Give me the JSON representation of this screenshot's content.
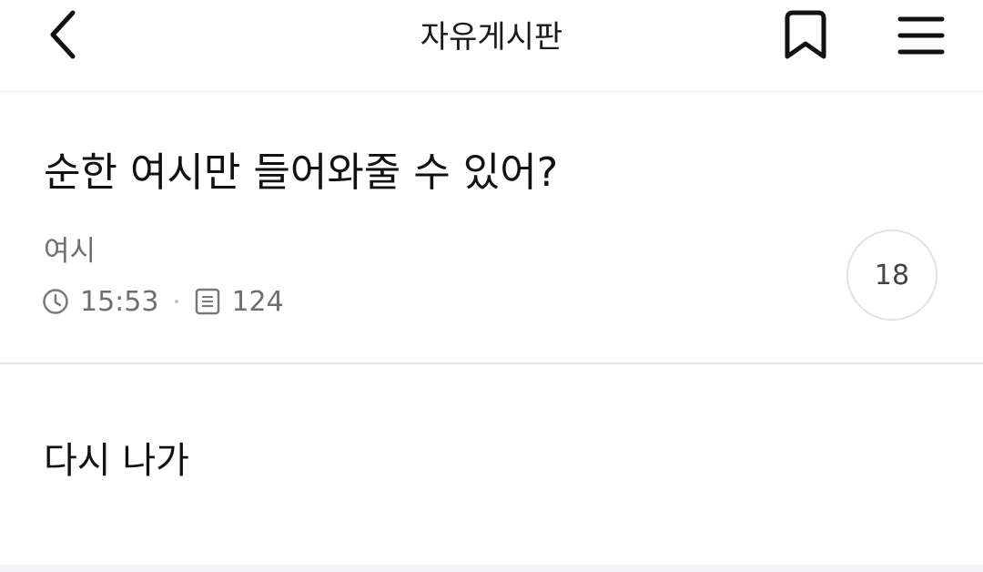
{
  "header": {
    "title": "자유게시판"
  },
  "post": {
    "title": "순한 여시만 들어와줄 수 있어?",
    "author": "여시",
    "time": "15:53",
    "views": "124",
    "comment_count": "18",
    "body": "다시 나가"
  },
  "icons": {
    "back": "chevron-left-icon",
    "bookmark": "bookmark-icon",
    "menu": "hamburger-menu-icon",
    "clock": "clock-icon",
    "views": "document-icon"
  }
}
